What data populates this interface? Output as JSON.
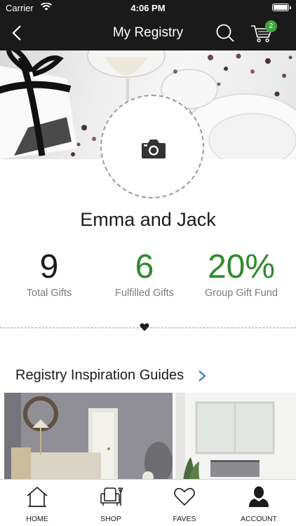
{
  "status_bar": {
    "carrier": "Carrier",
    "time": "4:06 PM"
  },
  "nav": {
    "title": "My Registry",
    "cart_count": "2"
  },
  "registry": {
    "couple_name": "Emma and Jack"
  },
  "stats": {
    "total_gifts": {
      "value": "9",
      "label": "Total Gifts"
    },
    "fulfilled_gifts": {
      "value": "6",
      "label": "Fulfilled Gifts"
    },
    "group_gift_fund": {
      "value": "20%",
      "label": "Group Gift Fund"
    }
  },
  "guides": {
    "title": "Registry Inspiration Guides"
  },
  "tab_bar": {
    "items": [
      {
        "label": "HOME",
        "icon": "house-icon"
      },
      {
        "label": "SHOP",
        "icon": "armchair-icon"
      },
      {
        "label": "FAVES",
        "icon": "heart-icon"
      },
      {
        "label": "ACCOUNT",
        "icon": "person-icon"
      }
    ]
  },
  "colors": {
    "header_bg": "#1a1a1a",
    "accent_green": "#2f8a2e",
    "badge_green": "#3aa83d"
  }
}
